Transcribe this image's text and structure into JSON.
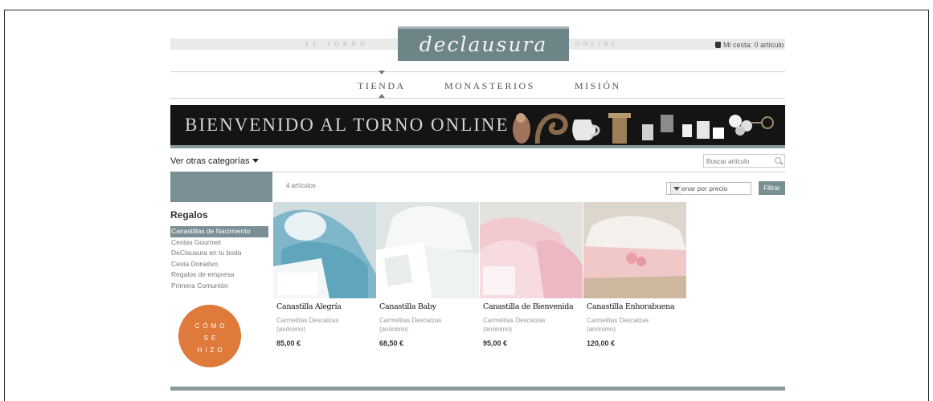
{
  "header": {
    "tagline_left": "EL TORNO",
    "logo_text": "declausura",
    "tagline_right": "ONLINE",
    "cart_label": "Mi cesta: 0 artículo"
  },
  "nav": {
    "items": [
      {
        "label": "TIENDA"
      },
      {
        "label": "MONASTERIOS"
      },
      {
        "label": "MISIÓN"
      }
    ]
  },
  "banner": {
    "title": "BIENVENIDO AL TORNO ONLINE"
  },
  "filters": {
    "categories_toggle": "Ver otras categorías",
    "search_placeholder": "Buscar artículo",
    "count_label": "4 artículos",
    "sort_label": "Ordenar por precio",
    "filter_button": "Filtrar"
  },
  "sidebar": {
    "title": "Regalos",
    "items": [
      {
        "label": "Canastillas de Nacimiento"
      },
      {
        "label": "Cestas Gourmet"
      },
      {
        "label": "DeClausura en tu boda"
      },
      {
        "label": "Cesta Donativo"
      },
      {
        "label": "Regalos de empresa"
      },
      {
        "label": "Primera Comunión"
      }
    ],
    "active_index": 0,
    "badge": {
      "line1": "CÓMO",
      "line2": "SE",
      "line3": "HIZO"
    }
  },
  "products": [
    {
      "name": "Canastilla Alegría",
      "vendor": "Carmelitas Descalzas",
      "author": "(anónimo)",
      "price": "85,00 €"
    },
    {
      "name": "Canastilla Baby",
      "vendor": "Carmelitas Descalzas",
      "author": "(anónimo)",
      "price": "68,50 €"
    },
    {
      "name": "Canastilla de Bienvenida",
      "vendor": "Carmelitas Descalzas",
      "author": "(anónimo)",
      "price": "95,00 €"
    },
    {
      "name": "Canastilla Enhorabuena",
      "vendor": "Carmelitas Descalzas",
      "author": "(anónimo)",
      "price": "120,00 €"
    }
  ],
  "colors": {
    "accent": "#7a8f93",
    "badge": "#df7a3b",
    "banner_bg": "#141414"
  }
}
